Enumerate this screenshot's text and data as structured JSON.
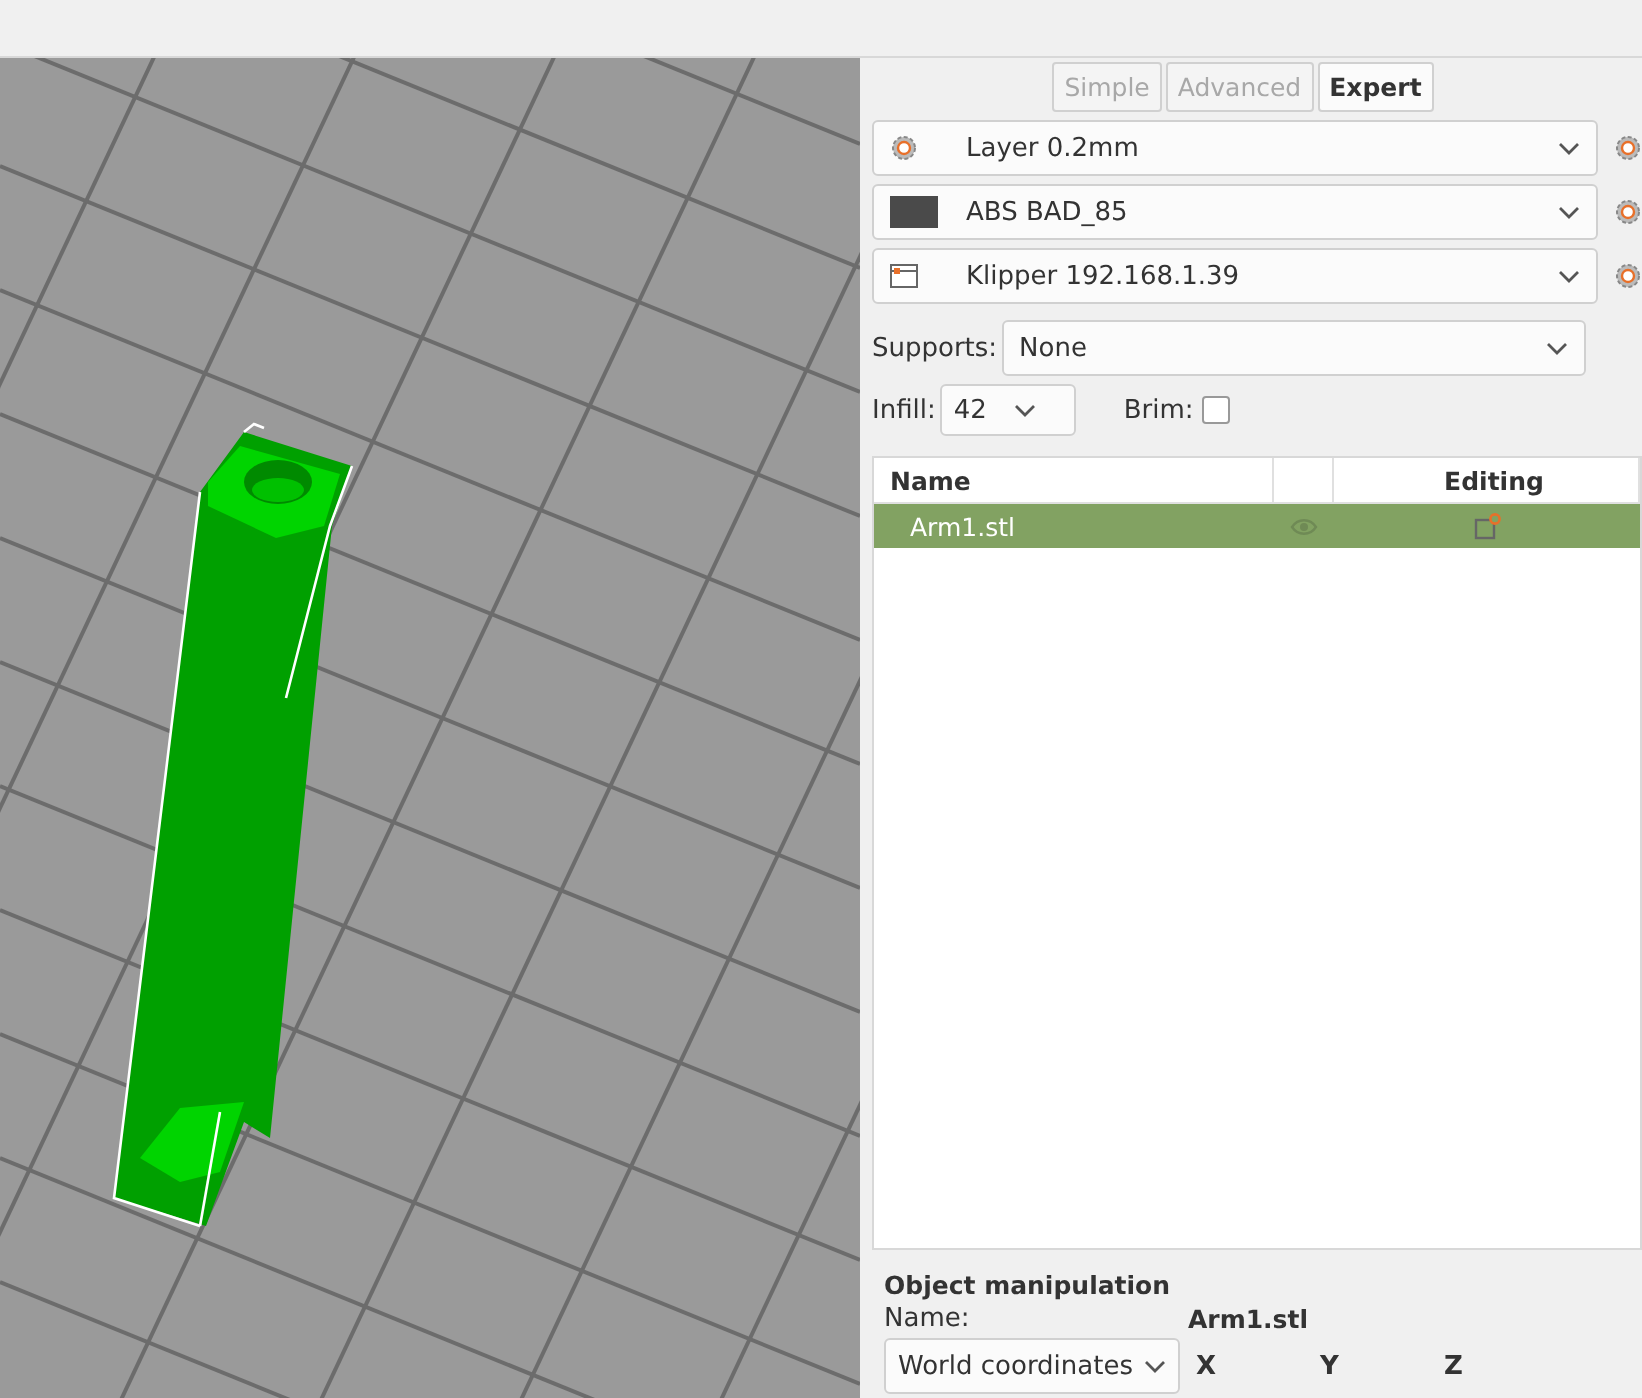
{
  "mode_tabs": [
    {
      "label": "Simple",
      "selected": false
    },
    {
      "label": "Advanced",
      "selected": false
    },
    {
      "label": "Expert",
      "selected": true
    }
  ],
  "presets": [
    {
      "kind": "print",
      "label": "Layer 0.2mm"
    },
    {
      "kind": "filament",
      "label": "ABS BAD_85",
      "color": "#4a4a4a"
    },
    {
      "kind": "printer",
      "label": "Klipper 192.168.1.39"
    }
  ],
  "supports": {
    "label": "Supports:",
    "value": "None"
  },
  "infill": {
    "label": "Infill:",
    "value": "42"
  },
  "brim": {
    "label": "Brim:",
    "checked": false
  },
  "object_list": {
    "name_column": "Name",
    "editing_column": "Editing",
    "rows": [
      {
        "name": "Arm1.stl",
        "selected": true
      }
    ]
  },
  "object_manipulation": {
    "title": "Object manipulation",
    "name_label": "Name:",
    "name_value": "Arm1.stl",
    "coordinates": "World coordinates",
    "axes": [
      "X",
      "Y",
      "Z"
    ]
  }
}
